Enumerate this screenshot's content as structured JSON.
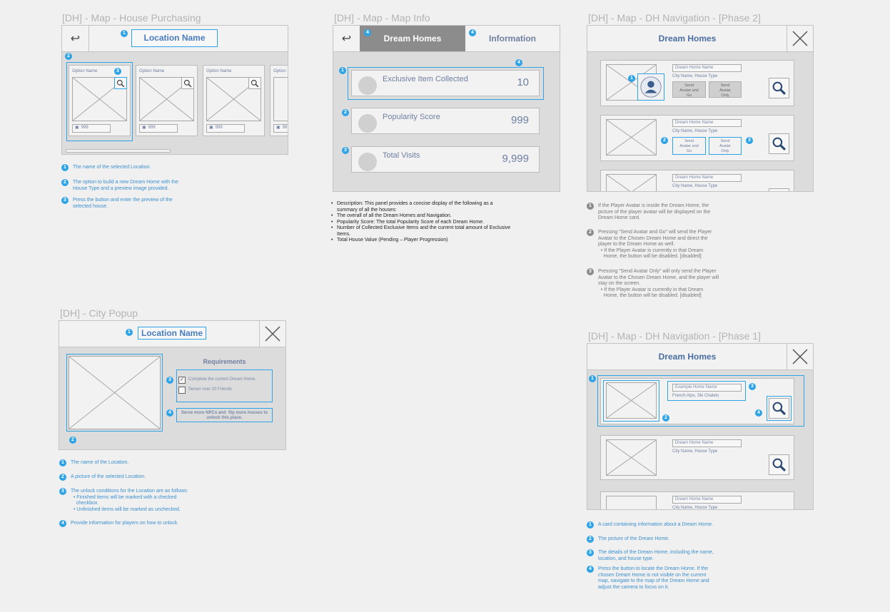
{
  "house_purchasing": {
    "title": "[DH] - Map - House Purchasing",
    "back_icon": "↩",
    "location_name": "Location Name",
    "option_label": "Option Name",
    "price_value": "999",
    "price_value_cut": "99",
    "option_label_cut": "Option",
    "notes": [
      {
        "n": "1",
        "text": "The name of the selected Location."
      },
      {
        "n": "2",
        "text": "The option to build a new Dream Home with the\nHouse Type and a preview image provided."
      },
      {
        "n": "3",
        "text": "Press the button and enter the preview of the\nselected house."
      }
    ]
  },
  "map_info": {
    "title": "[DH] - Map - Map Info",
    "back_icon": "↩",
    "tab_dream_homes": "Dream Homes",
    "tab_information": "Information",
    "rows": [
      {
        "label": "Exclusive Item Collected",
        "value": "10"
      },
      {
        "label": "Popularity Score",
        "value": "999"
      },
      {
        "label": "Total Visits",
        "value": "9,999"
      }
    ],
    "description": [
      "Description: This panel provides a concise display of the following as a\nsummary of all the houses:",
      "The overall of all the Dream Homes and Navigation.",
      "Popularity Score: The total Popularity Score of each Dream Home.",
      "Number of Collected Exclusive Items and the current total amount of Exclusive\nItems.",
      "Total House Value (Pending – Player Progression)"
    ]
  },
  "nav_phase2": {
    "title": "[DH] - Map - DH Navigation - [Phase 2]",
    "header": "Dream Homes",
    "home_name": "Dream Home Name",
    "city_type": "City Name, House Type",
    "send_avatar_go": "Send\nAvatar and\nGo",
    "send_avatar_only": "Send\nAvatar\nOnly",
    "notes": [
      {
        "n": "1",
        "text": "If the Player Avatar is inside the Dream Home, the\npicture of the player avatar will be displayed on the\nDream Home card."
      },
      {
        "n": "2",
        "text": "Pressing \"Send Avatar and Go\" will send the Player\nAvatar to the Chosen Dream Home and direct the\nplayer to the Dream Home as well.\n  • If the Player Avatar is currently in that Dream\n    Home, the button will be disabled. [disabled]"
      },
      {
        "n": "3",
        "text": "Pressing \"Send Avatar Only\" will only send the Player\nAvatar to the Chosen Dream Home, and the player will\nstay on the screen.\n  • If the Player Avatar is currently in that Dream\n    Home, the button will be disabled. [disabled]"
      }
    ]
  },
  "city_popup": {
    "title": "[DH] - City Popup",
    "location_name": "Location Name",
    "requirements_title": "Requirements",
    "req1": "Complete the current Dream Home.",
    "req2": "Server over 20 Friends.",
    "unlock_info": "Serve more NPCs and  flip more houses to\nunlock this place.",
    "notes": [
      {
        "n": "1",
        "text": "The name of the Location."
      },
      {
        "n": "2",
        "text": "A picture of the selected Location."
      },
      {
        "n": "3",
        "text": "The unlock conditions for the Location are as follows:\n  • Finished items will be marked with a checked\n    checkbox.\n  • Unfinished items will be marked as unchecked."
      },
      {
        "n": "4",
        "text": "Provide information for players on how to unlock."
      }
    ]
  },
  "nav_phase1": {
    "title": "[DH] - Map - DH Navigation - [Phase 1]",
    "header": "Dream Homes",
    "example_name": "Example Home Name",
    "example_loc": "French Alps, Ski Chalets",
    "home_name": "Dream Home Name",
    "city_type": "City Name, House Type",
    "notes": [
      {
        "n": "1",
        "text": "A card containing information about a Dream Home."
      },
      {
        "n": "2",
        "text": "The picture of the Dream Home."
      },
      {
        "n": "3",
        "text": "The details of the Dream Home, including the name,\nlocation, and house type."
      },
      {
        "n": "4",
        "text": "Press the button to locate the Dream Home. If the\nchosen Dream Home is not visible on the current\nmap, navigate to the map of the Dream Home and\nadjust the camera to focus on it."
      }
    ]
  }
}
